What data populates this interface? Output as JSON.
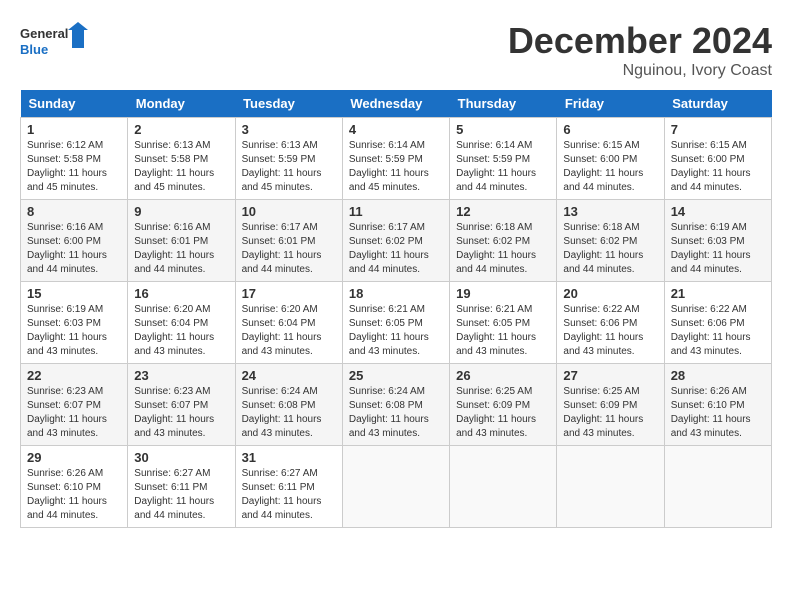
{
  "header": {
    "logo_line1": "General",
    "logo_line2": "Blue",
    "month": "December 2024",
    "location": "Nguinou, Ivory Coast"
  },
  "days_of_week": [
    "Sunday",
    "Monday",
    "Tuesday",
    "Wednesday",
    "Thursday",
    "Friday",
    "Saturday"
  ],
  "weeks": [
    [
      {
        "day": "1",
        "sunrise": "6:12 AM",
        "sunset": "5:58 PM",
        "daylight": "11 hours and 45 minutes."
      },
      {
        "day": "2",
        "sunrise": "6:13 AM",
        "sunset": "5:58 PM",
        "daylight": "11 hours and 45 minutes."
      },
      {
        "day": "3",
        "sunrise": "6:13 AM",
        "sunset": "5:59 PM",
        "daylight": "11 hours and 45 minutes."
      },
      {
        "day": "4",
        "sunrise": "6:14 AM",
        "sunset": "5:59 PM",
        "daylight": "11 hours and 45 minutes."
      },
      {
        "day": "5",
        "sunrise": "6:14 AM",
        "sunset": "5:59 PM",
        "daylight": "11 hours and 44 minutes."
      },
      {
        "day": "6",
        "sunrise": "6:15 AM",
        "sunset": "6:00 PM",
        "daylight": "11 hours and 44 minutes."
      },
      {
        "day": "7",
        "sunrise": "6:15 AM",
        "sunset": "6:00 PM",
        "daylight": "11 hours and 44 minutes."
      }
    ],
    [
      {
        "day": "8",
        "sunrise": "6:16 AM",
        "sunset": "6:00 PM",
        "daylight": "11 hours and 44 minutes."
      },
      {
        "day": "9",
        "sunrise": "6:16 AM",
        "sunset": "6:01 PM",
        "daylight": "11 hours and 44 minutes."
      },
      {
        "day": "10",
        "sunrise": "6:17 AM",
        "sunset": "6:01 PM",
        "daylight": "11 hours and 44 minutes."
      },
      {
        "day": "11",
        "sunrise": "6:17 AM",
        "sunset": "6:02 PM",
        "daylight": "11 hours and 44 minutes."
      },
      {
        "day": "12",
        "sunrise": "6:18 AM",
        "sunset": "6:02 PM",
        "daylight": "11 hours and 44 minutes."
      },
      {
        "day": "13",
        "sunrise": "6:18 AM",
        "sunset": "6:02 PM",
        "daylight": "11 hours and 44 minutes."
      },
      {
        "day": "14",
        "sunrise": "6:19 AM",
        "sunset": "6:03 PM",
        "daylight": "11 hours and 44 minutes."
      }
    ],
    [
      {
        "day": "15",
        "sunrise": "6:19 AM",
        "sunset": "6:03 PM",
        "daylight": "11 hours and 43 minutes."
      },
      {
        "day": "16",
        "sunrise": "6:20 AM",
        "sunset": "6:04 PM",
        "daylight": "11 hours and 43 minutes."
      },
      {
        "day": "17",
        "sunrise": "6:20 AM",
        "sunset": "6:04 PM",
        "daylight": "11 hours and 43 minutes."
      },
      {
        "day": "18",
        "sunrise": "6:21 AM",
        "sunset": "6:05 PM",
        "daylight": "11 hours and 43 minutes."
      },
      {
        "day": "19",
        "sunrise": "6:21 AM",
        "sunset": "6:05 PM",
        "daylight": "11 hours and 43 minutes."
      },
      {
        "day": "20",
        "sunrise": "6:22 AM",
        "sunset": "6:06 PM",
        "daylight": "11 hours and 43 minutes."
      },
      {
        "day": "21",
        "sunrise": "6:22 AM",
        "sunset": "6:06 PM",
        "daylight": "11 hours and 43 minutes."
      }
    ],
    [
      {
        "day": "22",
        "sunrise": "6:23 AM",
        "sunset": "6:07 PM",
        "daylight": "11 hours and 43 minutes."
      },
      {
        "day": "23",
        "sunrise": "6:23 AM",
        "sunset": "6:07 PM",
        "daylight": "11 hours and 43 minutes."
      },
      {
        "day": "24",
        "sunrise": "6:24 AM",
        "sunset": "6:08 PM",
        "daylight": "11 hours and 43 minutes."
      },
      {
        "day": "25",
        "sunrise": "6:24 AM",
        "sunset": "6:08 PM",
        "daylight": "11 hours and 43 minutes."
      },
      {
        "day": "26",
        "sunrise": "6:25 AM",
        "sunset": "6:09 PM",
        "daylight": "11 hours and 43 minutes."
      },
      {
        "day": "27",
        "sunrise": "6:25 AM",
        "sunset": "6:09 PM",
        "daylight": "11 hours and 43 minutes."
      },
      {
        "day": "28",
        "sunrise": "6:26 AM",
        "sunset": "6:10 PM",
        "daylight": "11 hours and 43 minutes."
      }
    ],
    [
      {
        "day": "29",
        "sunrise": "6:26 AM",
        "sunset": "6:10 PM",
        "daylight": "11 hours and 44 minutes."
      },
      {
        "day": "30",
        "sunrise": "6:27 AM",
        "sunset": "6:11 PM",
        "daylight": "11 hours and 44 minutes."
      },
      {
        "day": "31",
        "sunrise": "6:27 AM",
        "sunset": "6:11 PM",
        "daylight": "11 hours and 44 minutes."
      },
      null,
      null,
      null,
      null
    ]
  ]
}
